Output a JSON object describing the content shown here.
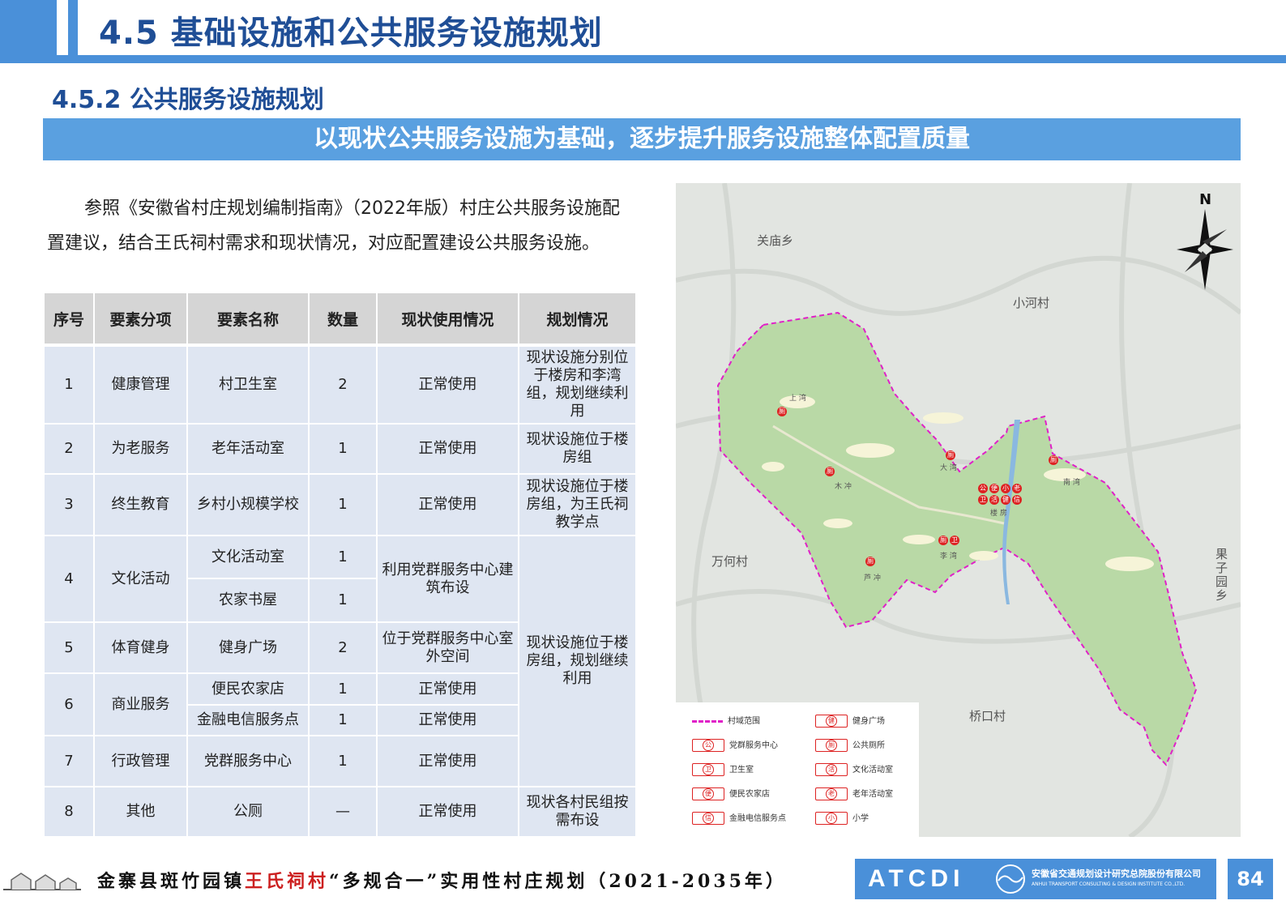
{
  "header": {
    "title": "4.5 基础设施和公共服务设施规划",
    "subtitle": "4.5.2 公共服务设施规划",
    "banner": "以现状公共服务设施为基础，逐步提升服务设施整体配置质量"
  },
  "intro": "参照《安徽省村庄规划编制指南》（2022年版）村庄公共服务设施配置建议，结合王氏祠村需求和现状情况，对应配置建设公共服务设施。",
  "table": {
    "headers": [
      "序号",
      "要素分项",
      "要素名称",
      "数量",
      "现状使用情况",
      "规划情况"
    ],
    "rows": [
      {
        "no": "1",
        "category": "健康管理",
        "name": "村卫生室",
        "count": "2",
        "status": "正常使用",
        "plan": "现状设施分别位于楼房和李湾组，规划继续利用"
      },
      {
        "no": "2",
        "category": "为老服务",
        "name": "老年活动室",
        "count": "1",
        "status": "正常使用",
        "plan": "现状设施位于楼房组"
      },
      {
        "no": "3",
        "category": "终生教育",
        "name": "乡村小规模学校",
        "count": "1",
        "status": "正常使用",
        "plan": "现状设施位于楼房组，为王氏祠教学点"
      },
      {
        "no": "4",
        "category": "文化活动",
        "name": "文化活动室",
        "count": "1",
        "status": "利用党群服务中心建筑布设",
        "plan": "现状设施位于楼房组，规划继续利用"
      },
      {
        "name": "农家书屋",
        "count": "1"
      },
      {
        "no": "5",
        "category": "体育健身",
        "name": "健身广场",
        "count": "2",
        "status": "位于党群服务中心室外空间"
      },
      {
        "no": "6",
        "category": "商业服务",
        "name": "便民农家店",
        "count": "1",
        "status": "正常使用"
      },
      {
        "name": "金融电信服务点",
        "count": "1",
        "status": "正常使用"
      },
      {
        "no": "7",
        "category": "行政管理",
        "name": "党群服务中心",
        "count": "1",
        "status": "正常使用"
      },
      {
        "no": "8",
        "category": "其他",
        "name": "公厕",
        "count": "—",
        "status": "正常使用",
        "plan": "现状各村民组按需布设"
      }
    ]
  },
  "map": {
    "north": "N",
    "places": {
      "guanmiao": "关庙乡",
      "xiaohe": "小河村",
      "wanhe": "万何村",
      "qiaokou": "桥口村",
      "guoziyuan": "果子园乡",
      "shangwan": "上 湾",
      "dawan": "大 湾",
      "muchong": "木 冲",
      "nanwan": "南 湾",
      "loufang": "楼 房",
      "liwan": "李 湾",
      "luchong": "芦 冲"
    },
    "markers": {
      "ce": "厕",
      "wei": "卫",
      "gong": "公",
      "bian": "便",
      "xiao": "小",
      "lao": "老",
      "huo": "活",
      "jian": "健",
      "xin": "信"
    },
    "legend": [
      {
        "label": "村域范围",
        "symbol": ""
      },
      {
        "label": "健身广场",
        "symbol": "健"
      },
      {
        "label": "党群服务中心",
        "symbol": "公"
      },
      {
        "label": "公共厕所",
        "symbol": "厕"
      },
      {
        "label": "卫生室",
        "symbol": "卫"
      },
      {
        "label": "文化活动室",
        "symbol": "活"
      },
      {
        "label": "便民农家店",
        "symbol": "便"
      },
      {
        "label": "老年活动室",
        "symbol": "老"
      },
      {
        "label": "金融电信服务点",
        "symbol": "信"
      },
      {
        "label": "小学",
        "symbol": "小"
      }
    ],
    "colors": {
      "village": "#b9d9a6",
      "boundary": "#e020c8",
      "marker": "#d22222",
      "river": "#8ab8e0"
    }
  },
  "footer": {
    "pre": "金寨县斑竹园镇",
    "village": "王氏祠村",
    "post": "“多规合一”实用性村庄规划（2021-2035年）",
    "logo": "ATCDI",
    "company_cn": "安徽省交通规划设计研究总院股份有限公司",
    "company_en": "ANHUI TRANSPORT CONSULTING & DESIGN INSTITUTE CO.,LTD.",
    "page": "84"
  },
  "colors": {
    "primary": "#4a90d9",
    "title": "#1f4e96",
    "banner": "#5aa0e0",
    "table_head": "#d5d5d5",
    "table_cell": "#dfe6f2"
  }
}
